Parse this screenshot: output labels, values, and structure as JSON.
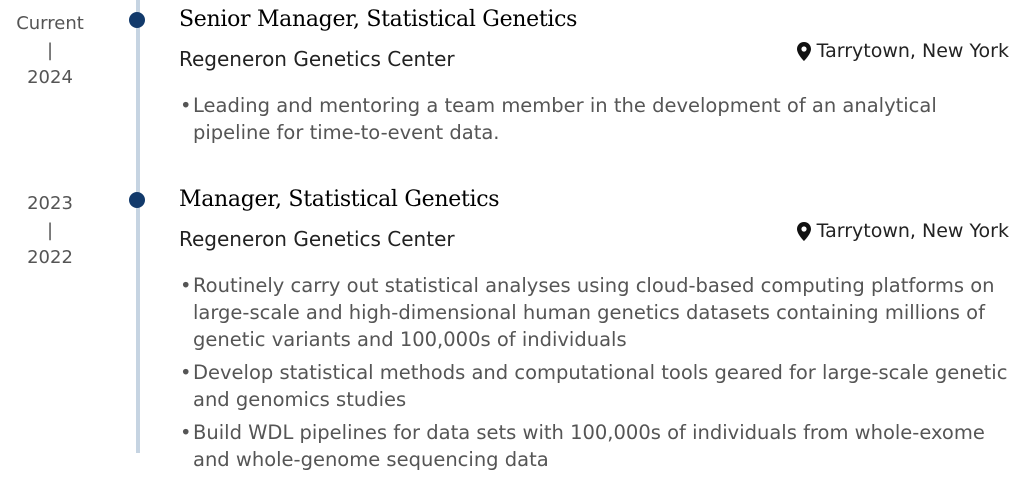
{
  "entries": [
    {
      "date_end": "Current",
      "date_sep": "|",
      "date_start": "2024",
      "title": "Senior Manager, Statistical Genetics",
      "organization": "Regeneron Genetics Center",
      "location": "Tarrytown, New York",
      "bullets": [
        "Leading and mentoring a team member in the development of an analytical pipeline for time-to-event data."
      ]
    },
    {
      "date_end": "2023",
      "date_sep": "|",
      "date_start": "2022",
      "title": "Manager, Statistical Genetics",
      "organization": "Regeneron Genetics Center",
      "location": "Tarrytown, New York",
      "bullets": [
        "Routinely carry out statistical analyses using cloud-based computing platforms on large-scale and high-dimensional human genetics datasets containing millions of genetic variants and 100,000s of individuals",
        "Develop statistical methods and computational tools geared for large-scale genetic and genomics studies",
        "Build WDL pipelines for data sets with 100,000s of individuals from whole-exome and whole-genome sequencing data"
      ]
    }
  ],
  "bullet_symbol": "•",
  "icons": {
    "location": "map-marker-icon"
  },
  "colors": {
    "dot": "#123a6b",
    "timeline": "#c6d4e2"
  }
}
